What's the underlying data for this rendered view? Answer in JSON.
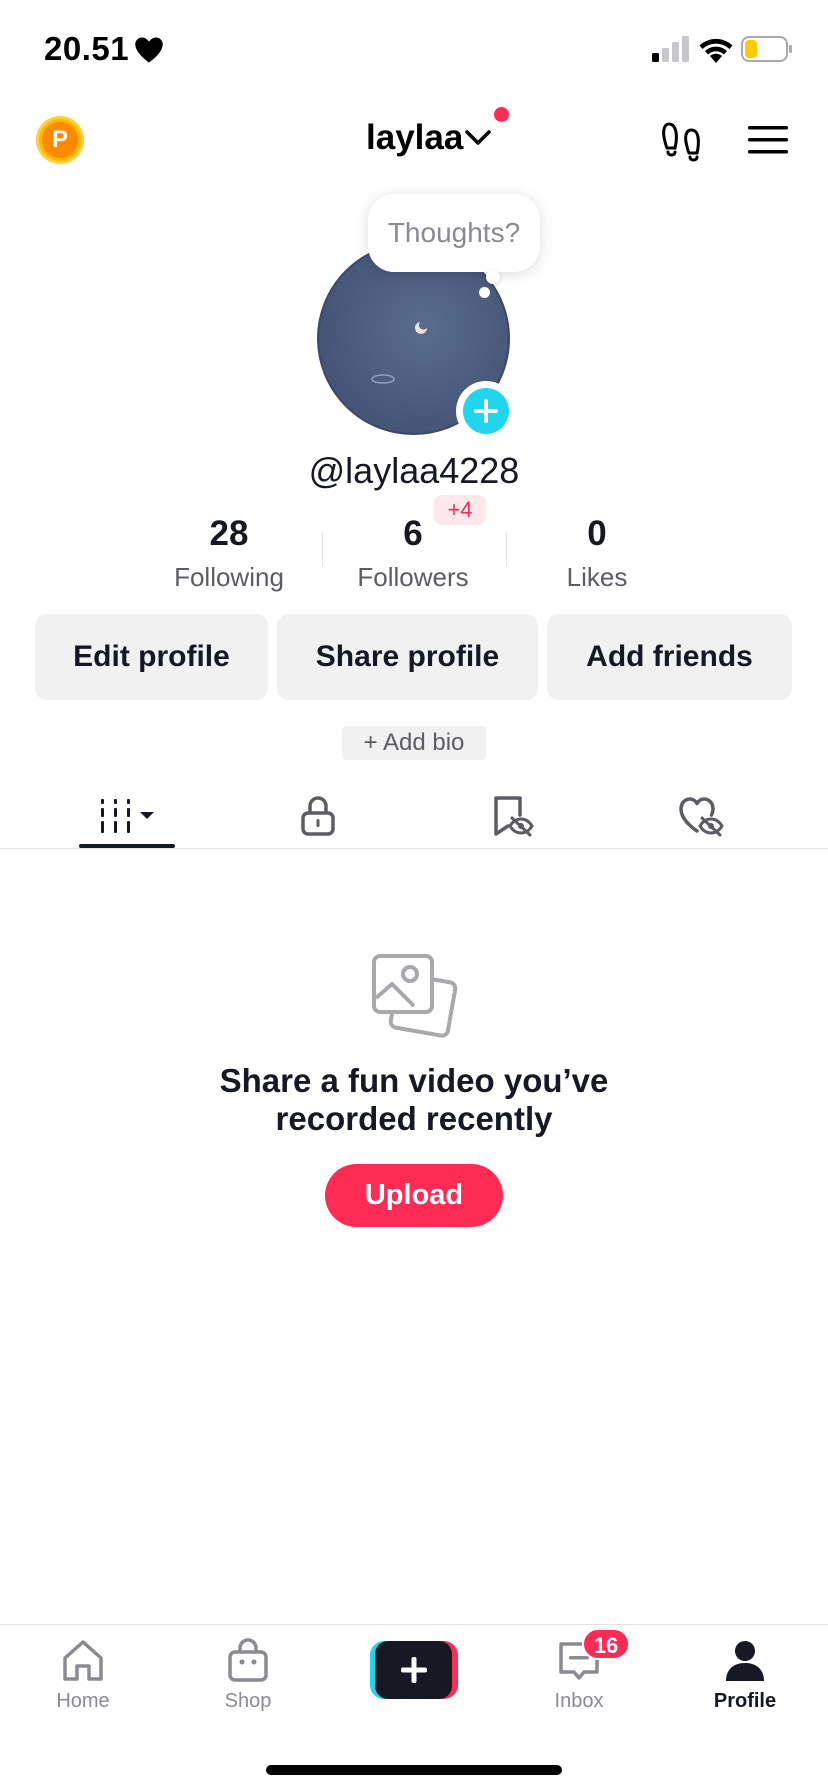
{
  "status_bar": {
    "time": "20.51",
    "battery_color": "#ffcc00"
  },
  "header": {
    "coin_letter": "P",
    "username": "laylaa"
  },
  "profile": {
    "thoughts_placeholder": "Thoughts?",
    "handle": "@laylaa4228",
    "stats": [
      {
        "value": "28",
        "label": "Following"
      },
      {
        "value": "6",
        "label": "Followers",
        "badge": "+4"
      },
      {
        "value": "0",
        "label": "Likes"
      }
    ],
    "actions": {
      "edit": "Edit profile",
      "share": "Share profile",
      "add_friends": "Add friends"
    },
    "add_bio": "+ Add bio"
  },
  "tabs": [
    {
      "icon": "videos-grid-icon",
      "active": true
    },
    {
      "icon": "lock-icon",
      "active": false
    },
    {
      "icon": "favorites-hidden-icon",
      "active": false
    },
    {
      "icon": "liked-hidden-icon",
      "active": false
    }
  ],
  "empty_state": {
    "message_line1": "Share a fun video you’ve",
    "message_line2": "recorded recently",
    "upload_label": "Upload"
  },
  "bottom_nav": {
    "home": "Home",
    "shop": "Shop",
    "inbox": "Inbox",
    "inbox_badge": "16",
    "profile": "Profile"
  },
  "colors": {
    "accent": "#fe2c55",
    "teal": "#20d5ec",
    "text": "#161823",
    "muted": "#8a8b91"
  }
}
